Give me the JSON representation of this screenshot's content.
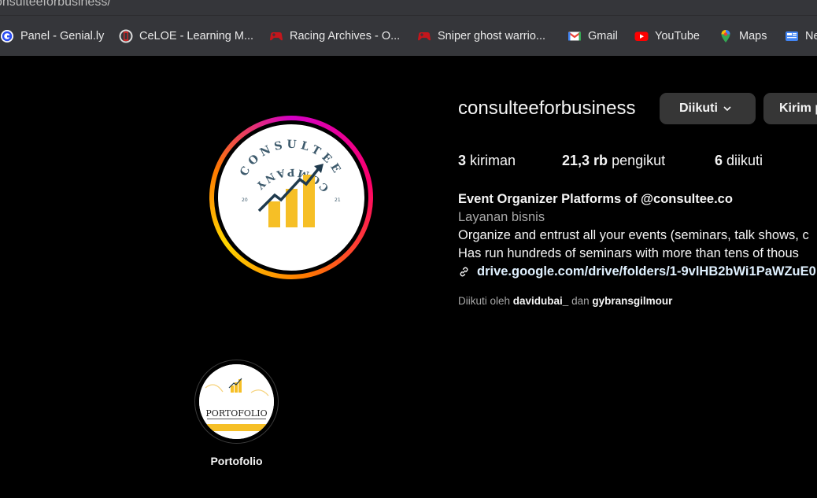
{
  "browser": {
    "url": "onsulteeforbusiness/",
    "bookmarks": [
      {
        "label": "Panel - Genial.ly",
        "icon": "genially-icon"
      },
      {
        "label": "CeLOE - Learning M...",
        "icon": "celoe-icon"
      },
      {
        "label": "Racing Archives - O...",
        "icon": "gamepad-icon"
      },
      {
        "label": "Sniper ghost warrio...",
        "icon": "gamepad-icon"
      },
      {
        "label": "Gmail",
        "icon": "gmail-icon"
      },
      {
        "label": "YouTube",
        "icon": "youtube-icon"
      },
      {
        "label": "Maps",
        "icon": "maps-icon"
      },
      {
        "label": "Ne",
        "icon": "news-icon"
      }
    ]
  },
  "profile": {
    "username": "consulteeforbusiness",
    "follow_button": "Diikuti",
    "message_button": "Kirim p",
    "stats": {
      "posts_count": "3",
      "posts_label": "kiriman",
      "followers_count": "21,3 rb",
      "followers_label": "pengikut",
      "following_count": "6",
      "following_label": "diikuti"
    },
    "bio": {
      "name": "Event Organizer Platforms of @consultee.co",
      "category": "Layanan bisnis",
      "line1": "Organize and entrust all your events (seminars, talk shows, c",
      "line2": "Has run hundreds of seminars with more than tens of thous",
      "link": "drive.google.com/drive/folders/1-9vlHB2bWi1PaWZuE0"
    },
    "followed_by": {
      "prefix": "Diikuti oleh",
      "user1": "davidubai_",
      "conjunction": "dan",
      "user2": "gybransgilmour"
    },
    "logo": {
      "top_text": "CONSULTEE",
      "bottom_text": "COMPANY",
      "left_mark": "20",
      "right_mark": "21"
    }
  },
  "highlights": [
    {
      "label": "Portofolio",
      "cover_text": "PORTOFOLIO"
    }
  ],
  "colors": {
    "background": "#000000",
    "button": "#363636",
    "chart_bars": "#f6bf26",
    "logo_text": "#3d5a6c"
  }
}
